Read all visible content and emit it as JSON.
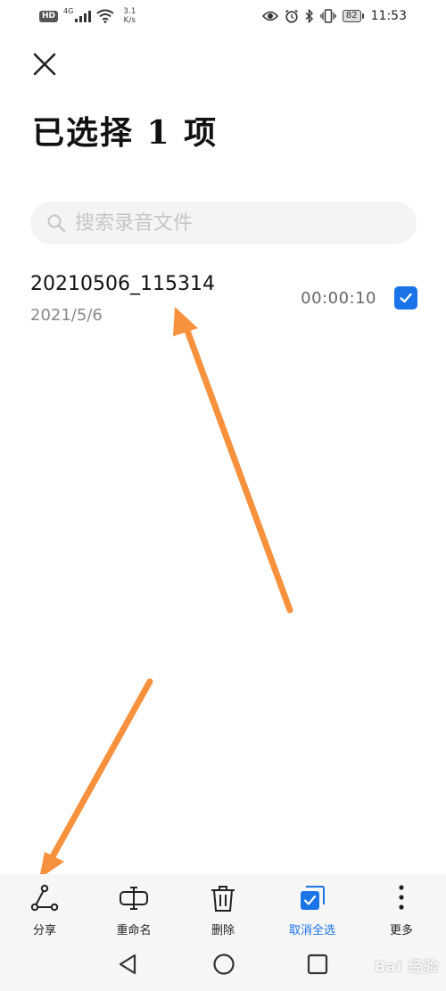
{
  "status_bar": {
    "hd": "HD",
    "network": "4G",
    "speed_value": "3.1",
    "speed_unit": "K/s",
    "battery": "82",
    "time": "11:53"
  },
  "header": {
    "title": "已选择 1 项"
  },
  "search": {
    "placeholder": "搜索录音文件"
  },
  "recordings": [
    {
      "name": "20210506_115314",
      "date": "2021/5/6",
      "duration": "00:00:10",
      "checked": true
    }
  ],
  "toolbar": {
    "share_label": "分享",
    "rename_label": "重命名",
    "delete_label": "删除",
    "deselect_all_label": "取消全选",
    "more_label": "更多"
  },
  "watermark": "Bai 经验",
  "colors": {
    "accent": "#1a74e8",
    "annotation_arrow": "#f7913d"
  }
}
